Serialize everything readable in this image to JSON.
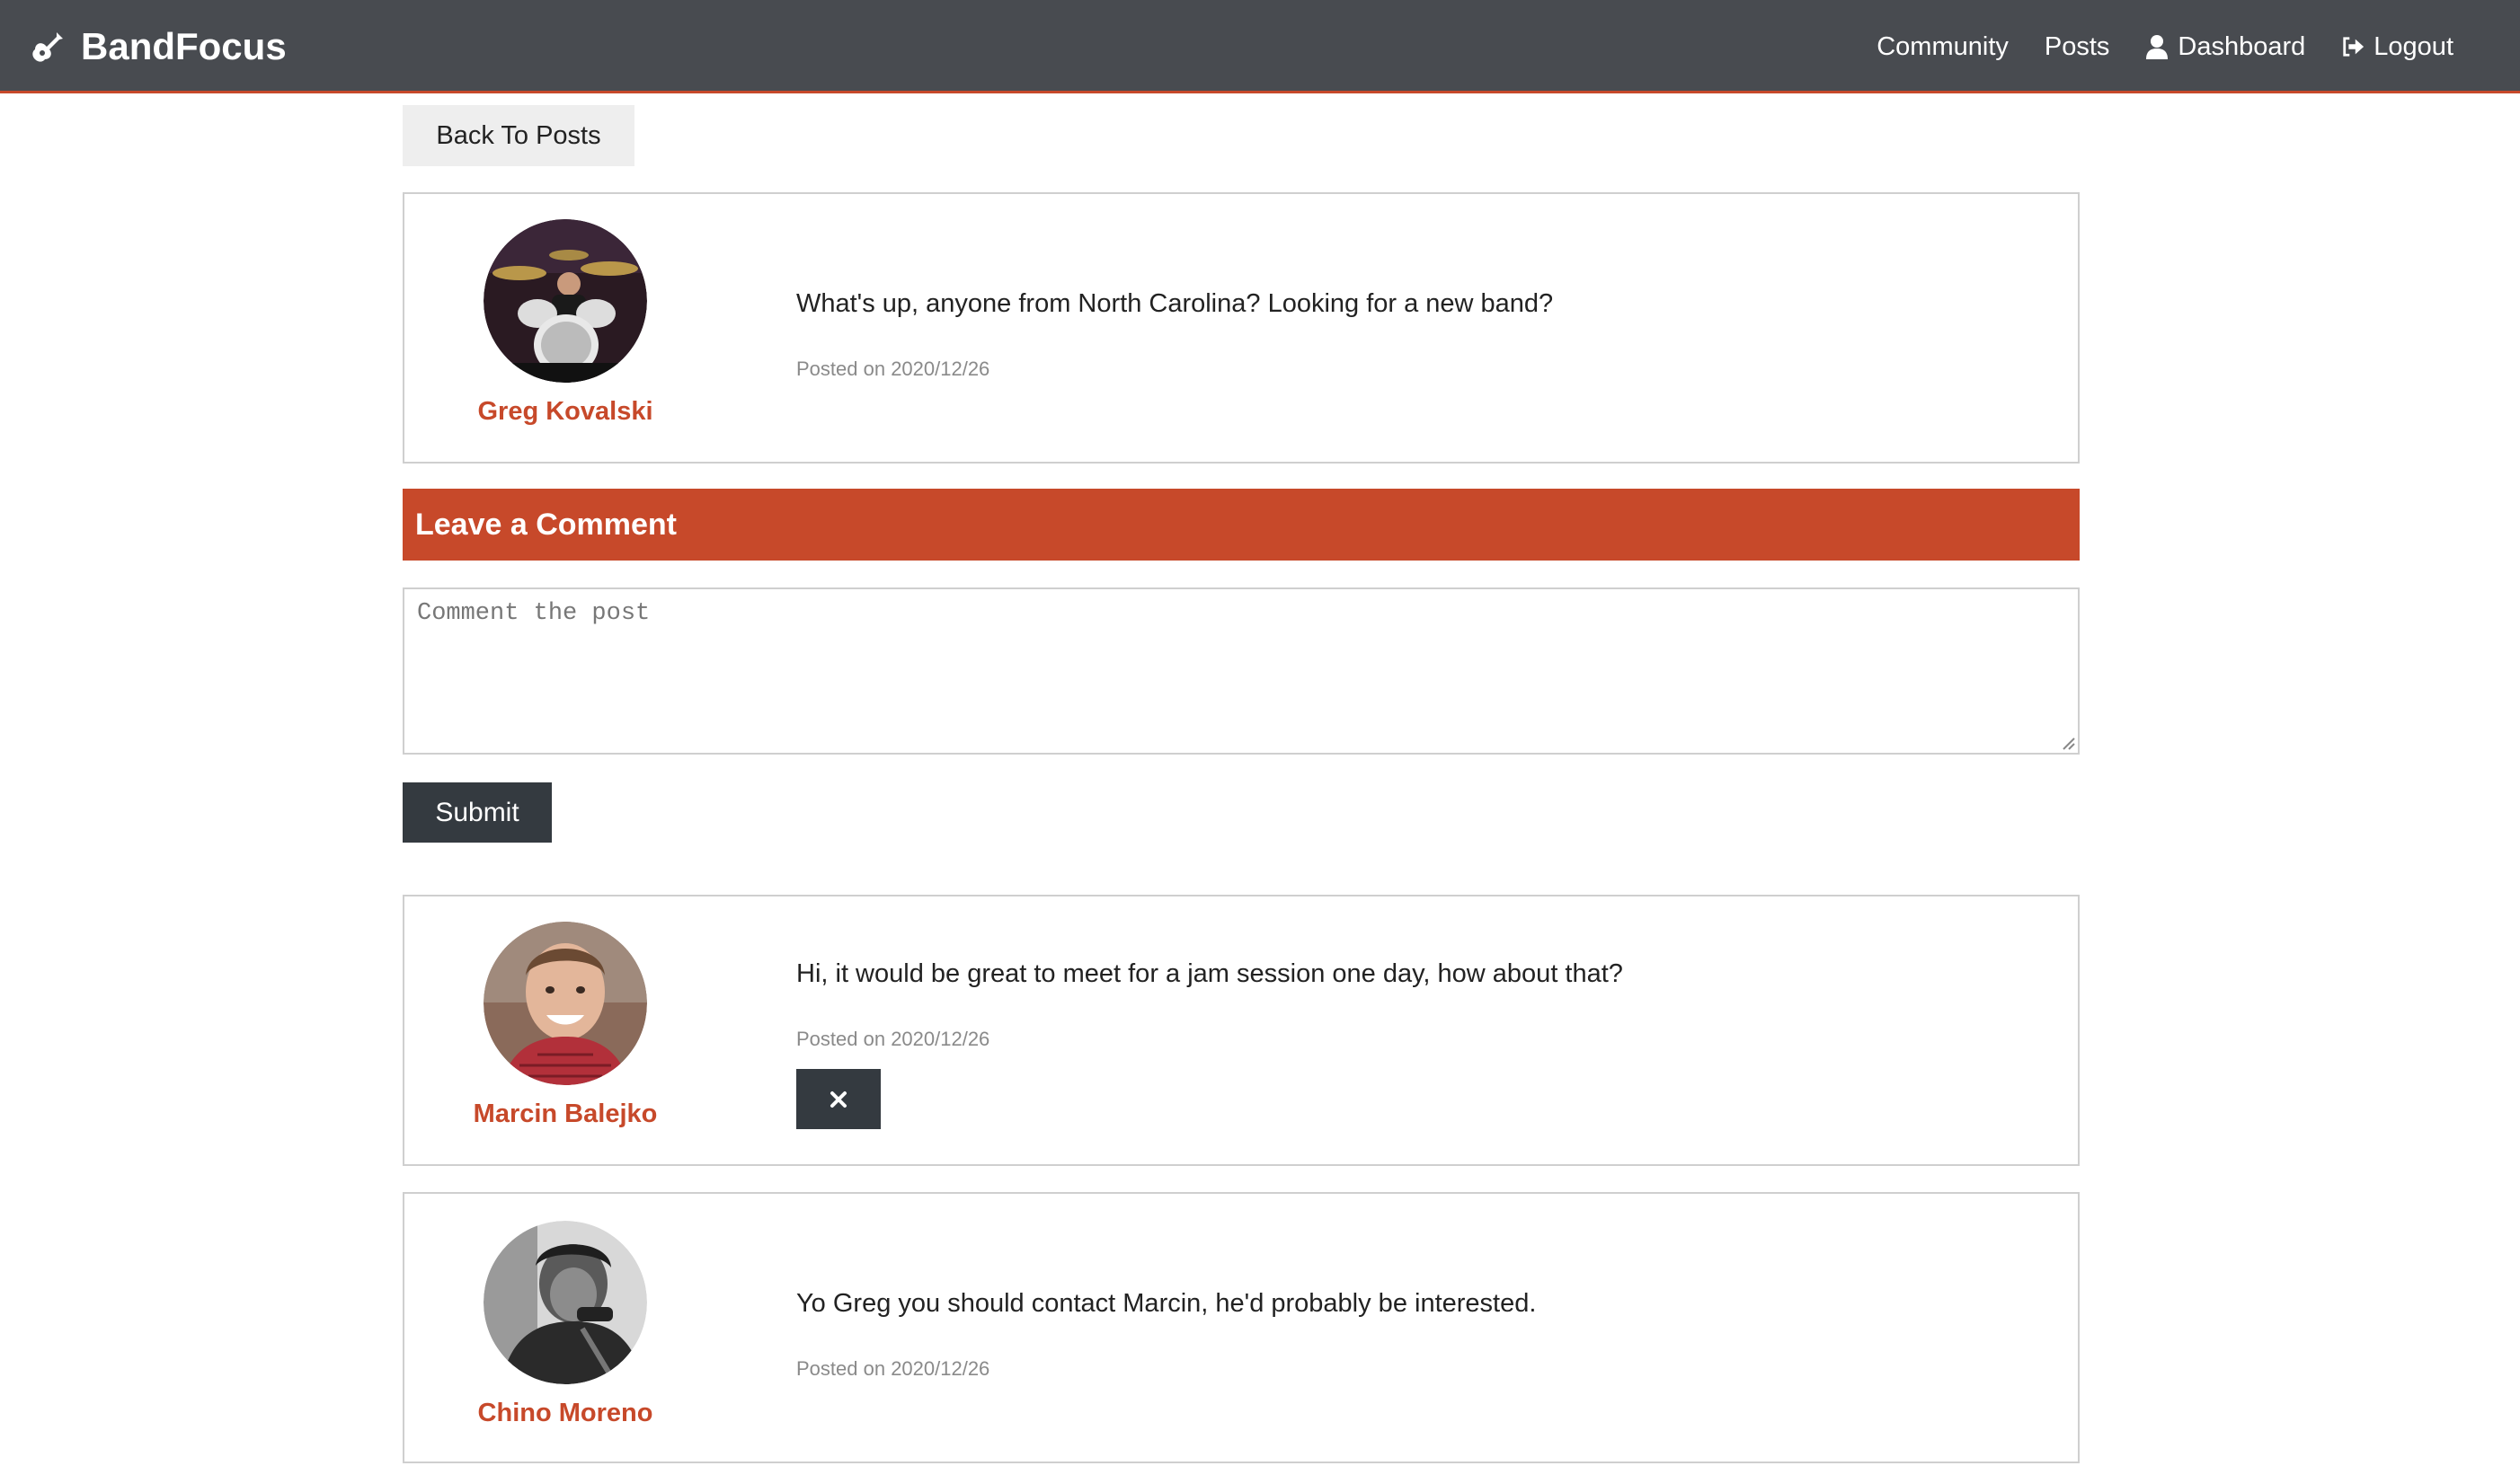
{
  "nav": {
    "brand": "BandFocus",
    "links": [
      {
        "label": "Community",
        "icon": null
      },
      {
        "label": "Posts",
        "icon": null
      },
      {
        "label": "Dashboard",
        "icon": "user-icon"
      },
      {
        "label": "Logout",
        "icon": "logout-icon"
      }
    ]
  },
  "back_button": "Back To Posts",
  "post": {
    "author": "Greg Kovalski",
    "text": "What's up, anyone from North Carolina? Looking for a new band?",
    "date": "Posted on 2020/12/26"
  },
  "comment_form": {
    "header": "Leave a Comment",
    "placeholder": "Comment the post",
    "value": "",
    "submit_label": "Submit"
  },
  "comments": [
    {
      "author": "Marcin Balejko",
      "text": "Hi, it would be great to meet for a jam session one day, how about that?",
      "date": "Posted on 2020/12/26",
      "deletable": true
    },
    {
      "author": "Chino Moreno",
      "text": "Yo Greg you should contact Marcin, he'd probably be interested.",
      "date": "Posted on 2020/12/26",
      "deletable": false
    }
  ],
  "colors": {
    "navbar": "#484b50",
    "accent": "#c7492a",
    "dark_button": "#343a40"
  }
}
